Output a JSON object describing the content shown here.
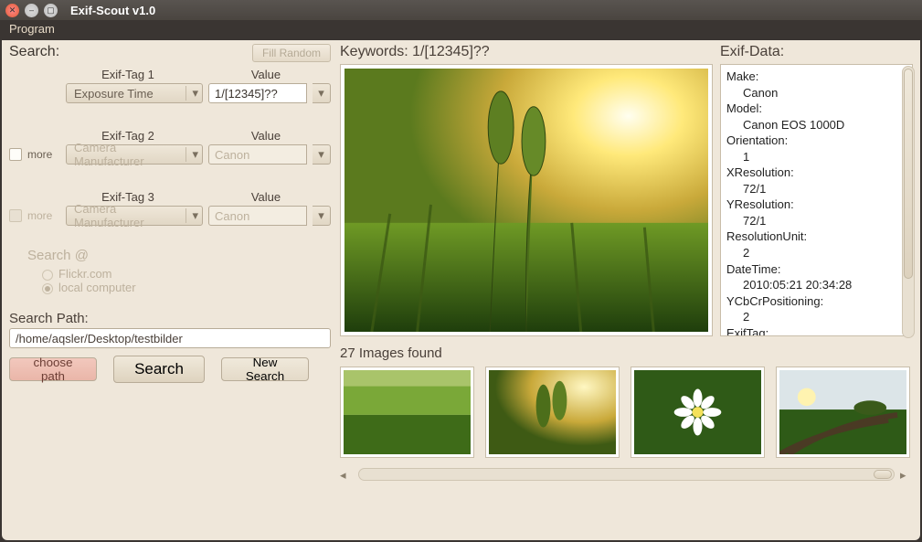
{
  "window": {
    "title": "Exif-Scout v1.0"
  },
  "menu": {
    "program": "Program"
  },
  "search": {
    "heading": "Search:",
    "fill_random": "Fill Random",
    "tag1": {
      "label": "Exif-Tag 1",
      "dropdown": "Exposure Time",
      "value_label": "Value",
      "value": "1/[12345]??"
    },
    "tag2": {
      "more": "more",
      "label": "Exif-Tag 2",
      "dropdown": "Camera Manufacturer",
      "value_label": "Value",
      "value": "Canon"
    },
    "tag3": {
      "more": "more",
      "label": "Exif-Tag 3",
      "dropdown": "Camera Manufacturer",
      "value_label": "Value",
      "value": "Canon"
    },
    "at": {
      "label": "Search @",
      "flickr": "Flickr.com",
      "local": "local computer"
    },
    "path": {
      "label": "Search Path:",
      "value": "/home/aqsler/Desktop/testbilder"
    },
    "buttons": {
      "choose": "choose path",
      "search": "Search",
      "new": "New Search"
    }
  },
  "preview": {
    "keywords_label": "Keywords:",
    "keywords_value": "1/[12345]??",
    "found_count": "27",
    "found_suffix": "Images found"
  },
  "exif": {
    "heading": "Exif-Data:",
    "items": [
      {
        "k": "Make:",
        "v": "Canon"
      },
      {
        "k": "Model:",
        "v": "Canon EOS 1000D"
      },
      {
        "k": "Orientation:",
        "v": "1"
      },
      {
        "k": "XResolution:",
        "v": "72/1"
      },
      {
        "k": "YResolution:",
        "v": "72/1"
      },
      {
        "k": "ResolutionUnit:",
        "v": "2"
      },
      {
        "k": "DateTime:",
        "v": "2010:05:21 20:34:28"
      },
      {
        "k": "YCbCrPositioning:",
        "v": "2"
      },
      {
        "k": "ExifTag:",
        "v": ""
      }
    ]
  }
}
